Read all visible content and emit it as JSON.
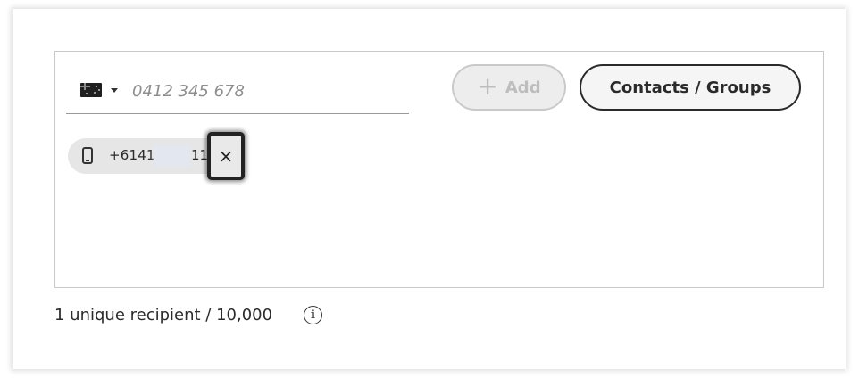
{
  "phone_entry": {
    "country_flag_icon": "australia-flag-icon",
    "caret_icon": "caret-down-icon",
    "value": "",
    "placeholder": "0412 345 678"
  },
  "buttons": {
    "add_label": "Add",
    "add_icon": "plus-icon",
    "contacts_label": "Contacts / Groups"
  },
  "recipients": [
    {
      "icon": "mobile-phone-icon",
      "number_prefix": "+6141",
      "number_suffix": "11",
      "remove_icon": "close-icon",
      "remove_symbol": "×"
    }
  ],
  "footer": {
    "count_text": "1 unique recipient / 10,000",
    "info_icon": "info-icon",
    "info_symbol": "i"
  },
  "colors": {
    "accent_dark": "#2a2a2a",
    "disabled_bg": "#ededed",
    "chip_bg": "#e6e6e6"
  }
}
